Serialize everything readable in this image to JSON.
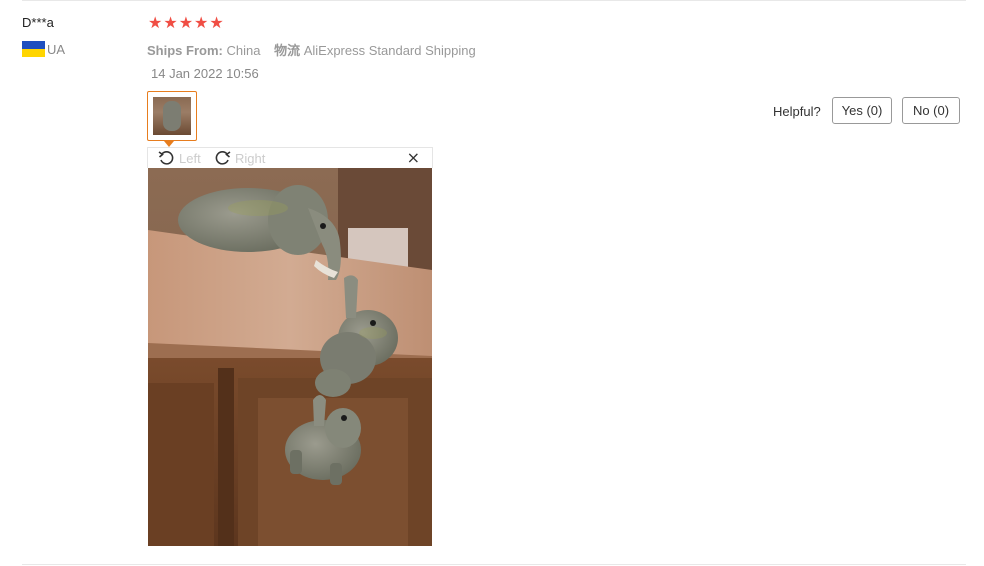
{
  "review": {
    "user_name": "D***a",
    "country_code": "UA",
    "rating": 5,
    "stars": [
      "★",
      "★",
      "★",
      "★",
      "★"
    ],
    "ships_from_label": "Ships From:",
    "ships_from_value": "China",
    "logistics_label": "物流",
    "logistics_value": "AliExpress Standard Shipping",
    "date": "14 Jan 2022 10:56"
  },
  "helpful": {
    "label": "Helpful?",
    "yes_label": "Yes (0)",
    "no_label": "No (0)"
  },
  "viewer": {
    "rotate_left_label": "Left",
    "rotate_right_label": "Right",
    "close_glyph": "×"
  },
  "colors": {
    "star": "#f04e44",
    "thumb_border": "#e77d1e",
    "flag_blue": "#1f4fbf",
    "flag_yellow": "#ffd500"
  },
  "icons": {
    "rotate_left": "rotate-left-icon",
    "rotate_right": "rotate-right-icon",
    "close": "close-icon",
    "flag": "ukraine-flag-icon"
  }
}
